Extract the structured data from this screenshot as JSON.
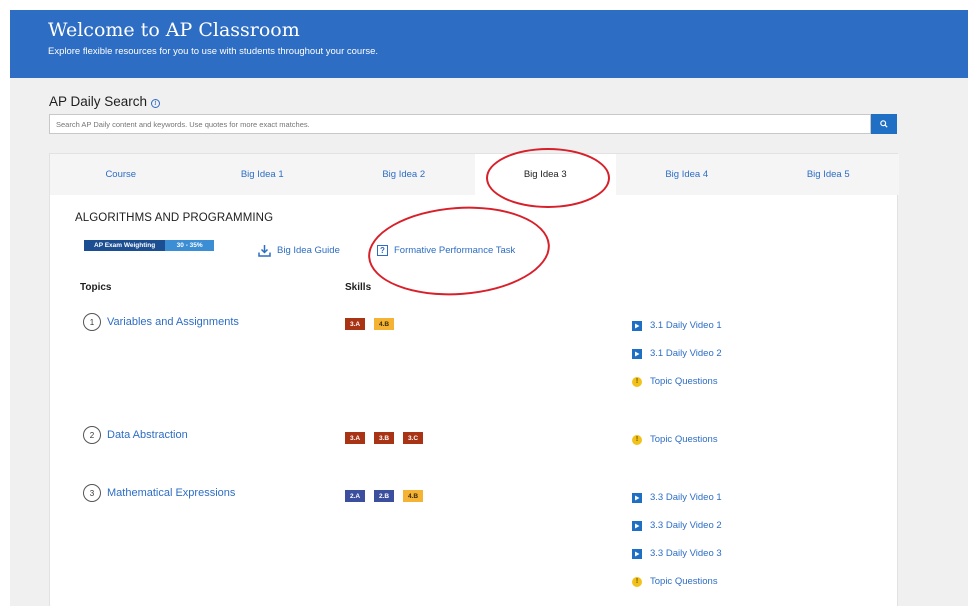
{
  "banner": {
    "title": "Welcome to AP Classroom",
    "subtitle": "Explore flexible resources for you to use with students throughout your course."
  },
  "search": {
    "title": "AP Daily Search",
    "info_icon": "info-icon",
    "placeholder": "Search AP Daily content and keywords. Use quotes for more exact matches.",
    "button_icon": "search-icon"
  },
  "tabs": [
    {
      "label": "Course"
    },
    {
      "label": "Big Idea 1"
    },
    {
      "label": "Big Idea 2"
    },
    {
      "label": "Big Idea 3",
      "active": true
    },
    {
      "label": "Big Idea 4"
    },
    {
      "label": "Big Idea 5"
    }
  ],
  "unit": {
    "title": "ALGORITHMS AND PROGRAMMING",
    "weighting_label": "AP Exam Weighting",
    "weighting_value": "30 - 35%",
    "guide_link": "Big Idea Guide",
    "fpt_link": "Formative Performance Task"
  },
  "columns": {
    "topics": "Topics",
    "skills": "Skills"
  },
  "topics": [
    {
      "number": "1",
      "name": "Variables and Assignments",
      "skills": [
        {
          "code": "3.A",
          "color": "#a83315"
        },
        {
          "code": "4.B",
          "color": "#f5b335"
        }
      ],
      "resources": [
        {
          "type": "video",
          "label": "3.1 Daily Video 1"
        },
        {
          "type": "video",
          "label": "3.1 Daily Video 2"
        },
        {
          "type": "questions",
          "label": "Topic Questions"
        }
      ]
    },
    {
      "number": "2",
      "name": "Data Abstraction",
      "skills": [
        {
          "code": "3.A",
          "color": "#a83315"
        },
        {
          "code": "3.B",
          "color": "#a83315"
        },
        {
          "code": "3.C",
          "color": "#a83315"
        }
      ],
      "resources": [
        {
          "type": "questions",
          "label": "Topic Questions"
        }
      ]
    },
    {
      "number": "3",
      "name": "Mathematical Expressions",
      "skills": [
        {
          "code": "2.A",
          "color": "#3c4e9e"
        },
        {
          "code": "2.B",
          "color": "#3c4e9e"
        },
        {
          "code": "4.B",
          "color": "#f5b335"
        }
      ],
      "resources": [
        {
          "type": "video",
          "label": "3.3 Daily Video 1"
        },
        {
          "type": "video",
          "label": "3.3 Daily Video 2"
        },
        {
          "type": "video",
          "label": "3.3 Daily Video 3"
        },
        {
          "type": "questions",
          "label": "Topic Questions"
        }
      ]
    }
  ],
  "colors": {
    "brand_blue": "#2d6dc4",
    "annotation_red": "#d8202a"
  }
}
